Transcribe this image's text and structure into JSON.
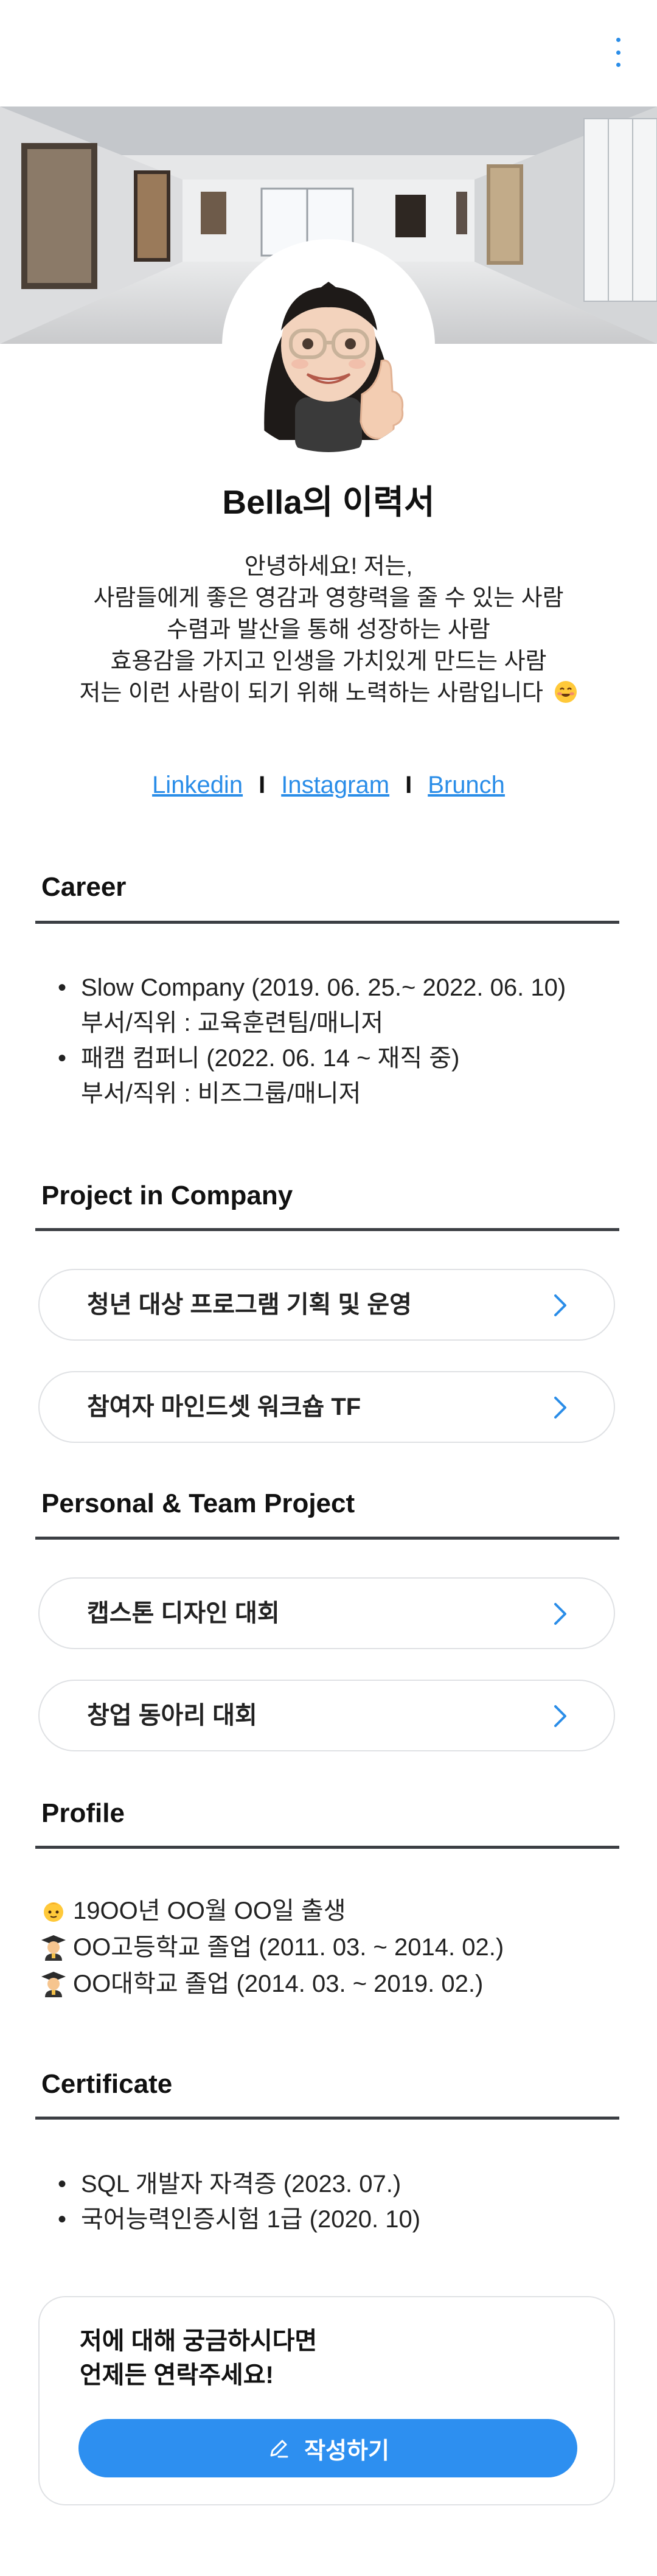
{
  "header": {
    "menu_icon": "kebab-menu-icon",
    "accent": "#2a8de8"
  },
  "cover": {
    "image": "gallery-interior-photo"
  },
  "profile": {
    "avatar": "memoji-avatar",
    "name": "Bella의 이력서",
    "intro": [
      "안녕하세요! 저는,",
      "사람들에게 좋은 영감과 영향력을 줄 수 있는 사람",
      "수렴과 발산을 통해 성장하는 사람",
      "효용감을 가지고 인생을 가치있게 만드는 사람",
      "저는 이런 사람이 되기 위해 노력하는 사람입니다"
    ],
    "intro_emoji": "smiling-face-emoji"
  },
  "links": {
    "linkedin": "Linkedin",
    "instagram": "Instagram",
    "brunch": "Brunch",
    "separator": "I"
  },
  "career": {
    "title": "Career",
    "items": [
      {
        "main": "Slow Company (2019. 06. 25.~ 2022. 06. 10)",
        "sub": "부서/직위 : 교육훈련팀/매니저"
      },
      {
        "main": "패캠 컴퍼니 (2022. 06. 14 ~ 재직 중)",
        "sub": "부서/직위 : 비즈그룹/매니저"
      }
    ]
  },
  "project_company": {
    "title": "Project in Company",
    "items": [
      "청년 대상 프로그램 기획 및 운영",
      "참여자 마인드셋 워크숍 TF"
    ]
  },
  "project_personal": {
    "title": "Personal & Team Project",
    "items": [
      "캡스톤 디자인 대회",
      "창업 동아리 대회"
    ]
  },
  "profile_section": {
    "title": "Profile",
    "lines": [
      {
        "icon": "baby-emoji",
        "text": "19OO년 OO월 OO일 출생"
      },
      {
        "icon": "graduate-emoji",
        "text": "OO고등학교 졸업 (2011. 03. ~ 2014. 02.)"
      },
      {
        "icon": "graduate-emoji",
        "text": "OO대학교 졸업 (2014. 03. ~ 2019. 02.)"
      }
    ]
  },
  "certificate": {
    "title": "Certificate",
    "items": [
      "SQL 개발자 자격증 (2023. 07.)",
      "국어능력인증시험 1급 (2020. 10)"
    ]
  },
  "contact": {
    "line1": "저에 대해 궁금하시다면",
    "line2": "언제든 연락주세요!",
    "button": "작성하기",
    "button_icon": "pencil-icon",
    "button_color": "#2d8ff0"
  }
}
